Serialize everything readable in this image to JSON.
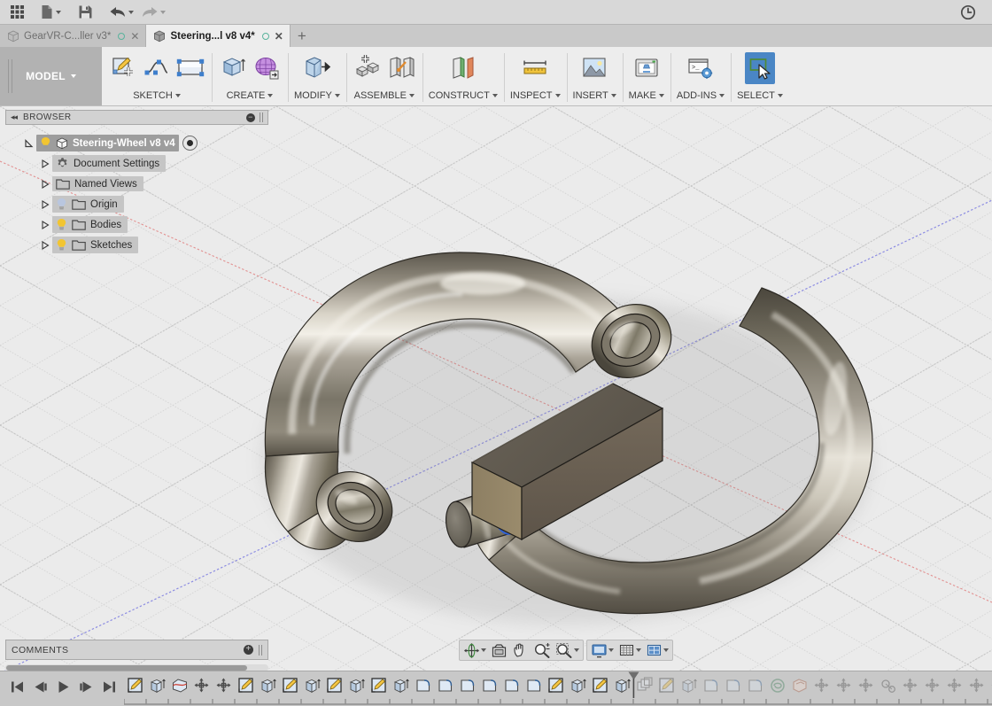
{
  "app": {
    "name": "Autodesk Fusion 360"
  },
  "quick_access": {
    "items": [
      {
        "name": "app-grid-icon",
        "label": "Show Data Panel",
        "icon": "grid",
        "caret": false
      },
      {
        "name": "file-icon",
        "label": "File",
        "icon": "file",
        "caret": true
      },
      {
        "name": "save-icon",
        "label": "Save",
        "icon": "save",
        "caret": false
      },
      {
        "name": "undo-icon",
        "label": "Undo",
        "icon": "undo",
        "caret": true
      },
      {
        "name": "redo-icon",
        "label": "Redo",
        "icon": "redo",
        "caret": true,
        "dim": true
      }
    ],
    "right": {
      "name": "history-clock-icon",
      "label": "Job Status"
    }
  },
  "tabs": {
    "items": [
      {
        "label": "GearVR-C...ller v3*",
        "active": false,
        "modified": true,
        "closable": true
      },
      {
        "label": "Steering...l v8 v4*",
        "active": true,
        "modified": true,
        "closable": true
      }
    ],
    "add_label": "+"
  },
  "ribbon": {
    "workspace": {
      "label": "MODEL",
      "has_caret": true
    },
    "groups": [
      {
        "label": "SKETCH",
        "caret": true,
        "icons": [
          {
            "name": "create-sketch-icon",
            "glyph": "sketch-new"
          },
          {
            "name": "spline-icon",
            "glyph": "spline"
          },
          {
            "name": "rectangle-icon",
            "glyph": "rect"
          }
        ]
      },
      {
        "label": "CREATE",
        "caret": true,
        "icons": [
          {
            "name": "extrude-icon",
            "glyph": "extrude"
          },
          {
            "name": "create-form-icon",
            "glyph": "form"
          }
        ]
      },
      {
        "label": "MODIFY",
        "caret": true,
        "icons": [
          {
            "name": "press-pull-icon",
            "glyph": "presspull"
          }
        ]
      },
      {
        "label": "ASSEMBLE",
        "caret": true,
        "icons": [
          {
            "name": "new-component-icon",
            "glyph": "newcomp"
          },
          {
            "name": "joint-icon",
            "glyph": "joint"
          }
        ]
      },
      {
        "label": "CONSTRUCT",
        "caret": true,
        "icons": [
          {
            "name": "offset-plane-icon",
            "glyph": "plane"
          }
        ]
      },
      {
        "label": "INSPECT",
        "caret": true,
        "icons": [
          {
            "name": "measure-icon",
            "glyph": "measure"
          }
        ]
      },
      {
        "label": "INSERT",
        "caret": true,
        "icons": [
          {
            "name": "insert-mcmaster-icon",
            "glyph": "image"
          }
        ]
      },
      {
        "label": "MAKE",
        "caret": true,
        "icons": [
          {
            "name": "3d-print-icon",
            "glyph": "printer"
          }
        ]
      },
      {
        "label": "ADD-INS",
        "caret": true,
        "icons": [
          {
            "name": "scripts-addins-icon",
            "glyph": "script"
          }
        ]
      },
      {
        "label": "SELECT",
        "caret": true,
        "selected": true,
        "icons": [
          {
            "name": "select-tool-icon",
            "glyph": "select",
            "selected": true
          }
        ]
      }
    ]
  },
  "browser": {
    "title": "BROWSER",
    "collapse_label": "◂◂",
    "minimize_label": "–",
    "tree": [
      {
        "name": "root",
        "label": "Steering-Wheel v8 v4",
        "depth": 0,
        "expanded": true,
        "bulb": "on",
        "icon": "component",
        "radio": true
      },
      {
        "name": "document-settings",
        "label": "Document Settings",
        "depth": 1,
        "expanded": false,
        "bulb": "none",
        "icon": "gear"
      },
      {
        "name": "named-views",
        "label": "Named Views",
        "depth": 1,
        "expanded": false,
        "bulb": "none",
        "icon": "folder"
      },
      {
        "name": "origin",
        "label": "Origin",
        "depth": 1,
        "expanded": false,
        "bulb": "off",
        "icon": "folder"
      },
      {
        "name": "bodies",
        "label": "Bodies",
        "depth": 1,
        "expanded": false,
        "bulb": "on",
        "icon": "folder"
      },
      {
        "name": "sketches",
        "label": "Sketches",
        "depth": 1,
        "expanded": false,
        "bulb": "on",
        "icon": "folder"
      }
    ]
  },
  "comments": {
    "title": "COMMENTS",
    "add_label": "+"
  },
  "navigation_bar": {
    "group_a": [
      {
        "name": "orbit-icon",
        "label": "Orbit",
        "caret": true
      },
      {
        "name": "look-at-icon",
        "label": "Look At",
        "caret": false
      },
      {
        "name": "pan-icon",
        "label": "Pan",
        "caret": false
      },
      {
        "name": "zoom-icon",
        "label": "Zoom",
        "caret": false
      },
      {
        "name": "fit-icon",
        "label": "Fit",
        "caret": true
      }
    ],
    "group_b": [
      {
        "name": "display-settings-icon",
        "label": "Display Settings",
        "caret": true
      },
      {
        "name": "grid-snaps-icon",
        "label": "Grid and Snaps",
        "caret": true
      },
      {
        "name": "viewports-icon",
        "label": "Viewports",
        "caret": true
      }
    ]
  },
  "timeline": {
    "playback": [
      {
        "name": "timeline-begin-button",
        "label": "Go to beginning",
        "glyph": "skip-back"
      },
      {
        "name": "timeline-step-back-button",
        "label": "Step back",
        "glyph": "step-back"
      },
      {
        "name": "timeline-play-button",
        "label": "Play",
        "glyph": "play"
      },
      {
        "name": "timeline-step-fwd-button",
        "label": "Step forward",
        "glyph": "step-fwd"
      },
      {
        "name": "timeline-end-button",
        "label": "Go to end",
        "glyph": "skip-fwd"
      }
    ],
    "marker_index": 22,
    "features": [
      {
        "glyph": "sketch",
        "dim": false
      },
      {
        "glyph": "extrude",
        "dim": false
      },
      {
        "glyph": "loft",
        "dim": false
      },
      {
        "glyph": "move",
        "dim": false
      },
      {
        "glyph": "move",
        "dim": false
      },
      {
        "glyph": "sketch",
        "dim": false
      },
      {
        "glyph": "extrude",
        "dim": false
      },
      {
        "glyph": "sketch",
        "dim": false
      },
      {
        "glyph": "extrude",
        "dim": false
      },
      {
        "glyph": "sketch",
        "dim": false
      },
      {
        "glyph": "extrude",
        "dim": false
      },
      {
        "glyph": "sketch",
        "dim": false
      },
      {
        "glyph": "extrude",
        "dim": false
      },
      {
        "glyph": "fillet",
        "dim": false
      },
      {
        "glyph": "fillet",
        "dim": false
      },
      {
        "glyph": "fillet",
        "dim": false
      },
      {
        "glyph": "fillet",
        "dim": false
      },
      {
        "glyph": "fillet",
        "dim": false
      },
      {
        "glyph": "fillet",
        "dim": false
      },
      {
        "glyph": "sketch",
        "dim": false
      },
      {
        "glyph": "extrude",
        "dim": false
      },
      {
        "glyph": "sketch",
        "dim": false
      },
      {
        "glyph": "extrude",
        "dim": false
      },
      {
        "glyph": "pattern",
        "dim": true
      },
      {
        "glyph": "sketch",
        "dim": true
      },
      {
        "glyph": "extrude",
        "dim": true
      },
      {
        "glyph": "fillet",
        "dim": true
      },
      {
        "glyph": "fillet",
        "dim": true
      },
      {
        "glyph": "fillet",
        "dim": true
      },
      {
        "glyph": "thread",
        "dim": true
      },
      {
        "glyph": "shell",
        "dim": true
      },
      {
        "glyph": "move",
        "dim": true
      },
      {
        "glyph": "move",
        "dim": true
      },
      {
        "glyph": "move",
        "dim": true
      },
      {
        "glyph": "joint",
        "dim": true
      },
      {
        "glyph": "move",
        "dim": true
      },
      {
        "glyph": "move",
        "dim": true
      },
      {
        "glyph": "move",
        "dim": true
      },
      {
        "glyph": "move",
        "dim": true
      },
      {
        "glyph": "move",
        "dim": true
      },
      {
        "glyph": "sketch",
        "dim": true
      }
    ]
  },
  "viewport": {
    "background_color": "#ebebeb",
    "grid": {
      "visible": true,
      "color": "#d3d3d3"
    },
    "axes": [
      {
        "name": "x-axis",
        "color": "#e06666"
      },
      {
        "name": "y-axis",
        "color": "#6666e0"
      }
    ],
    "bodies": [
      {
        "name": "steering-wheel-ring",
        "shape": "c-shaped-torus",
        "color": "#8a857a",
        "material": "polished-metal"
      },
      {
        "name": "hub-block",
        "shape": "rectangular-box",
        "color": "#6e6658",
        "material": "brass"
      },
      {
        "name": "shaft-cylinder",
        "shape": "cylinder",
        "color": "#7d786e",
        "material": "metal"
      }
    ],
    "selection": {
      "name": "selected-circular-edge",
      "color": "#2b5fd9",
      "type": "circle",
      "center_point": true
    }
  }
}
